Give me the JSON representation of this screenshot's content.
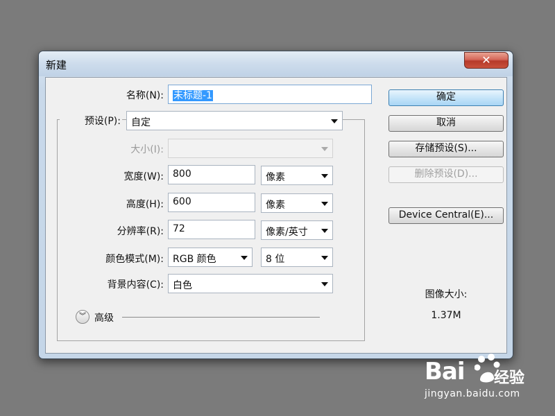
{
  "window": {
    "title": "新建",
    "close_symbol": "✕"
  },
  "form": {
    "name": {
      "label": "名称(N):",
      "value": "未标题-1"
    },
    "preset": {
      "label": "预设(P):",
      "value": "自定"
    },
    "size": {
      "label": "大小(I):",
      "value": ""
    },
    "width": {
      "label": "宽度(W):",
      "value": "800",
      "unit": "像素"
    },
    "height": {
      "label": "高度(H):",
      "value": "600",
      "unit": "像素"
    },
    "resolution": {
      "label": "分辨率(R):",
      "value": "72",
      "unit": "像素/英寸"
    },
    "color_mode": {
      "label": "颜色模式(M):",
      "value": "RGB 颜色",
      "depth": "8 位"
    },
    "background": {
      "label": "背景内容(C):",
      "value": "白色"
    },
    "advanced": {
      "label": "高级",
      "icon": "chevron-double-down-icon"
    }
  },
  "buttons": {
    "ok": "确定",
    "cancel": "取消",
    "save_preset": "存储预设(S)...",
    "delete_preset": "删除预设(D)...",
    "device_central": "Device Central(E)..."
  },
  "image_size": {
    "label": "图像大小:",
    "value": "1.37M"
  },
  "watermark": {
    "logo": "Bai",
    "logo_cn": "经验",
    "url": "jingyan.baidu.com"
  },
  "colors": {
    "accent": "#3399ff",
    "close": "#c9513c",
    "background": "#7b7b7b"
  }
}
